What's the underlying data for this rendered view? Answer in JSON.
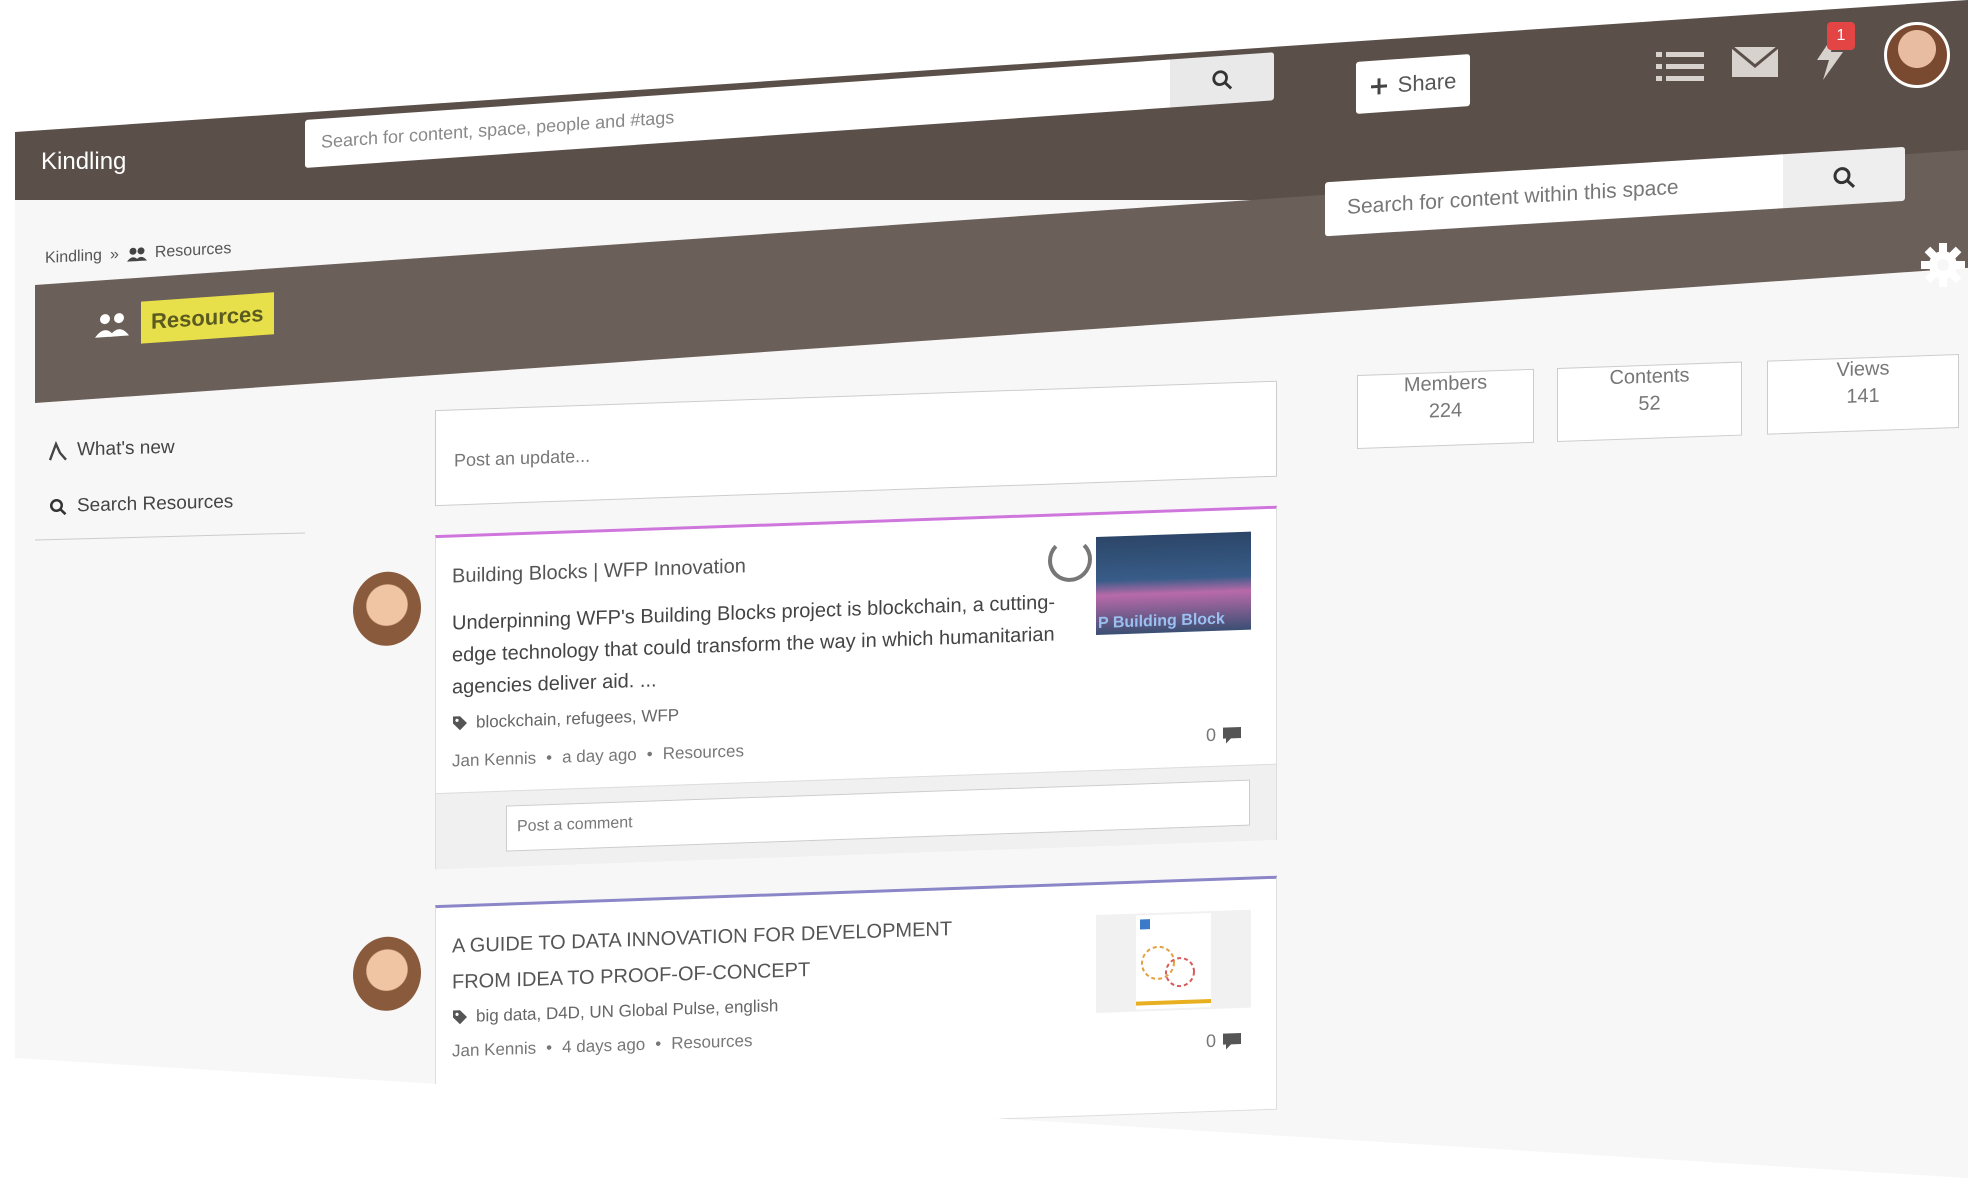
{
  "app": {
    "brand": "Kindling"
  },
  "topbar": {
    "search_placeholder": "Search for content, space, people and #tags",
    "share_label": "Share",
    "notification_count": "1"
  },
  "breadcrumb": {
    "root": "Kindling",
    "separator": "»",
    "current": "Resources"
  },
  "space": {
    "title": "Resources",
    "search_placeholder": "Search for content within this space"
  },
  "sidebar": {
    "items": [
      {
        "label": "What's new",
        "icon": "activity-icon"
      },
      {
        "label": "Search Resources",
        "icon": "search-icon"
      }
    ]
  },
  "feed": {
    "post_placeholder": "Post an update...",
    "posts": [
      {
        "title": "Building Blocks | WFP Innovation",
        "description": "Underpinning WFP's Building Blocks project is blockchain, a cutting-edge technology that could transform the way in which humanitarian agencies deliver aid. ...",
        "tags": "blockchain, refugees, WFP",
        "author": "Jan Kennis",
        "time": "a day ago",
        "space": "Resources",
        "comment_count": "0",
        "thumbnail_text": "P Building Block",
        "comment_placeholder": "Post a comment",
        "accent": "#cf76dd"
      },
      {
        "title": "A GUIDE TO DATA INNOVATION FOR DEVELOPMENT",
        "subtitle": "FROM IDEA TO PROOF-OF-CONCEPT",
        "tags": "big data, D4D, UN Global Pulse, english",
        "author": "Jan Kennis",
        "time": "4 days ago",
        "space": "Resources",
        "comment_count": "0",
        "accent": "#8b86c8"
      }
    ]
  },
  "stats": {
    "members": {
      "label": "Members",
      "value": "224"
    },
    "contents": {
      "label": "Contents",
      "value": "52"
    },
    "views": {
      "label": "Views",
      "value": "141"
    }
  },
  "colors": {
    "topbar": "#5b4f49",
    "space_header": "#6b5f59",
    "highlight": "#e8e04a",
    "badge": "#e34444"
  }
}
